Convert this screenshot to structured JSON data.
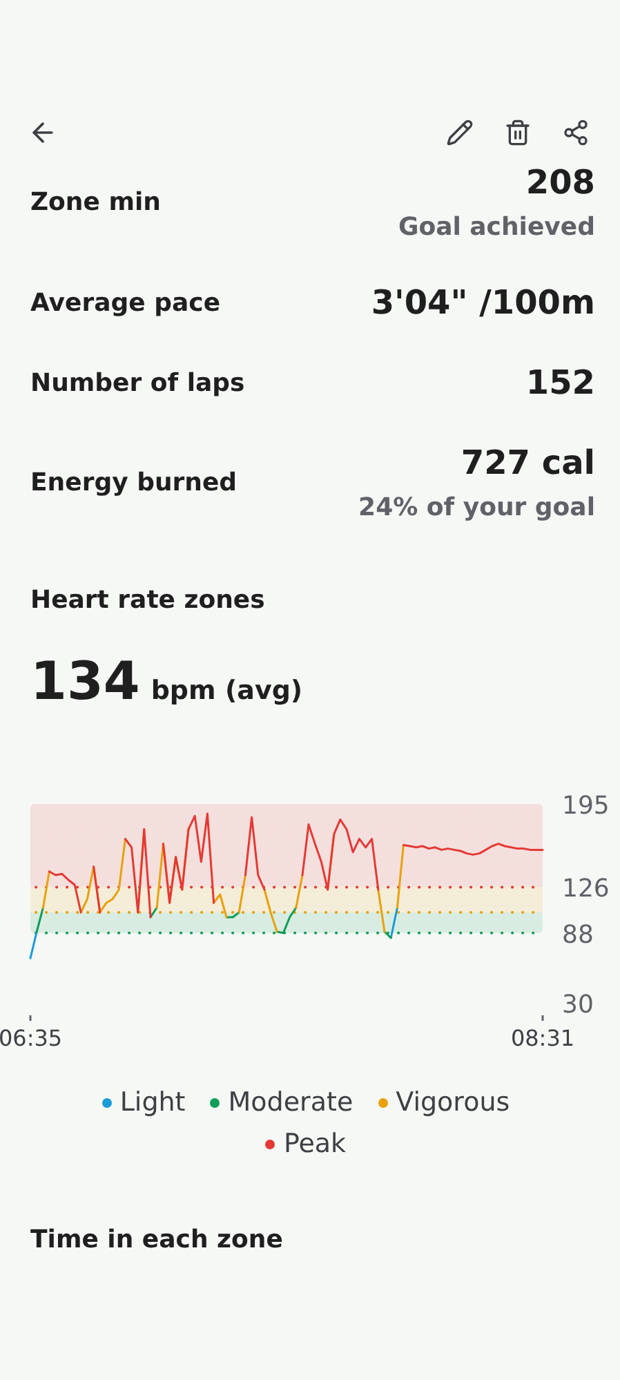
{
  "metrics": [
    {
      "label": "Zone min",
      "value": "208",
      "note": "Goal achieved"
    },
    {
      "label": "Average pace",
      "value": "3'04\" /100m"
    },
    {
      "label": "Number of laps",
      "value": "152"
    },
    {
      "label": "Energy burned",
      "value": "727 cal",
      "note": "24% of your goal"
    }
  ],
  "heart_rate": {
    "title": "Heart rate zones",
    "average": "134",
    "unit": "bpm (avg)",
    "chart_data": {
      "type": "line",
      "categories": [
        "06:35",
        null,
        null,
        null,
        null,
        null,
        null,
        null,
        null,
        null,
        null,
        null,
        null,
        null,
        null,
        null,
        null,
        null,
        null,
        null,
        null,
        null,
        null,
        null,
        null,
        null,
        null,
        null,
        null,
        null,
        null,
        null,
        null,
        null,
        null,
        null,
        null,
        null,
        null,
        null,
        null,
        null,
        null,
        null,
        null,
        null,
        null,
        null,
        null,
        null,
        null,
        null,
        null,
        null,
        null,
        null,
        null,
        null,
        null,
        null,
        null,
        null,
        null,
        null,
        null,
        null,
        null,
        null,
        null,
        null,
        null,
        null,
        null,
        null,
        null,
        null,
        null,
        null,
        null,
        null,
        null,
        "08:31"
      ],
      "series": [
        {
          "name": "Light",
          "color": "#1a9bd7",
          "values": [
            67,
            89,
            null,
            null,
            null,
            null,
            null,
            null,
            null,
            null,
            null,
            null,
            null,
            null,
            null,
            null,
            null,
            null,
            null,
            null,
            null,
            null,
            null,
            null,
            null,
            null,
            null,
            null,
            null,
            null,
            null,
            null,
            null,
            null,
            null,
            null,
            null,
            null,
            null,
            null,
            null,
            null,
            null,
            null,
            null,
            null,
            null,
            null,
            null,
            null,
            null,
            null,
            null,
            null,
            null,
            null,
            null,
            84,
            109,
            null,
            null,
            null,
            null,
            null,
            null,
            null,
            null,
            null,
            null,
            null,
            null,
            null,
            null,
            null,
            null,
            null,
            null,
            null,
            null,
            null,
            null,
            null
          ]
        },
        {
          "name": "Moderate",
          "color": "#0f9d58",
          "values": [
            null,
            89,
            109,
            null,
            null,
            null,
            null,
            null,
            null,
            null,
            null,
            null,
            null,
            null,
            null,
            null,
            null,
            null,
            null,
            101,
            109,
            null,
            null,
            null,
            null,
            null,
            null,
            null,
            null,
            null,
            null,
            101,
            101,
            105,
            null,
            null,
            null,
            null,
            null,
            89,
            88,
            101,
            109,
            null,
            null,
            null,
            null,
            null,
            null,
            null,
            null,
            null,
            null,
            null,
            null,
            null,
            89,
            84,
            null,
            null,
            null,
            null,
            null,
            null,
            null,
            null,
            null,
            null,
            null,
            null,
            null,
            null,
            null,
            null,
            null,
            null,
            null,
            null,
            null,
            null,
            null,
            null
          ]
        },
        {
          "name": "Vigorous",
          "color": "#e8a10c",
          "values": [
            null,
            null,
            109,
            139,
            null,
            null,
            null,
            null,
            105,
            116,
            143,
            105,
            113,
            116,
            124,
            166,
            null,
            105,
            174,
            null,
            109,
            162,
            113,
            151,
            124,
            174,
            null,
            null,
            null,
            113,
            120,
            101,
            null,
            105,
            136,
            null,
            null,
            124,
            105,
            89,
            null,
            null,
            109,
            136,
            null,
            null,
            null,
            124,
            170,
            null,
            null,
            null,
            null,
            null,
            null,
            124,
            89,
            null,
            109,
            161,
            null,
            null,
            null,
            null,
            null,
            null,
            null,
            null,
            null,
            null,
            null,
            null,
            null,
            null,
            null,
            null,
            null,
            null,
            null,
            null,
            null,
            null
          ]
        },
        {
          "name": "Peak",
          "color": "#e53935",
          "values": [
            null,
            null,
            null,
            139,
            136,
            137,
            132,
            128,
            105,
            null,
            143,
            105,
            null,
            null,
            null,
            166,
            159,
            105,
            174,
            101,
            null,
            162,
            113,
            151,
            124,
            174,
            185,
            147,
            187,
            113,
            null,
            null,
            null,
            null,
            136,
            184,
            136,
            124,
            null,
            null,
            null,
            null,
            null,
            136,
            178,
            162,
            147,
            124,
            170,
            182,
            174,
            155,
            166,
            159,
            166,
            124,
            null,
            null,
            null,
            161,
            160,
            159,
            160,
            158,
            159,
            157,
            158,
            157,
            156,
            154,
            153,
            154,
            157,
            160,
            162,
            160,
            159,
            158,
            158,
            157,
            157,
            157
          ]
        }
      ],
      "ylim": [
        30,
        195
      ],
      "ref_lines": [
        {
          "axis": "y",
          "value": 88,
          "color": "#0f9d58"
        },
        {
          "axis": "y",
          "value": 105,
          "color": "#e8a10c"
        },
        {
          "axis": "y",
          "value": 126,
          "color": "#e53935"
        }
      ],
      "yticks": [
        195,
        126,
        88,
        30
      ]
    }
  },
  "zones_section": {
    "title": "Time in each zone"
  }
}
